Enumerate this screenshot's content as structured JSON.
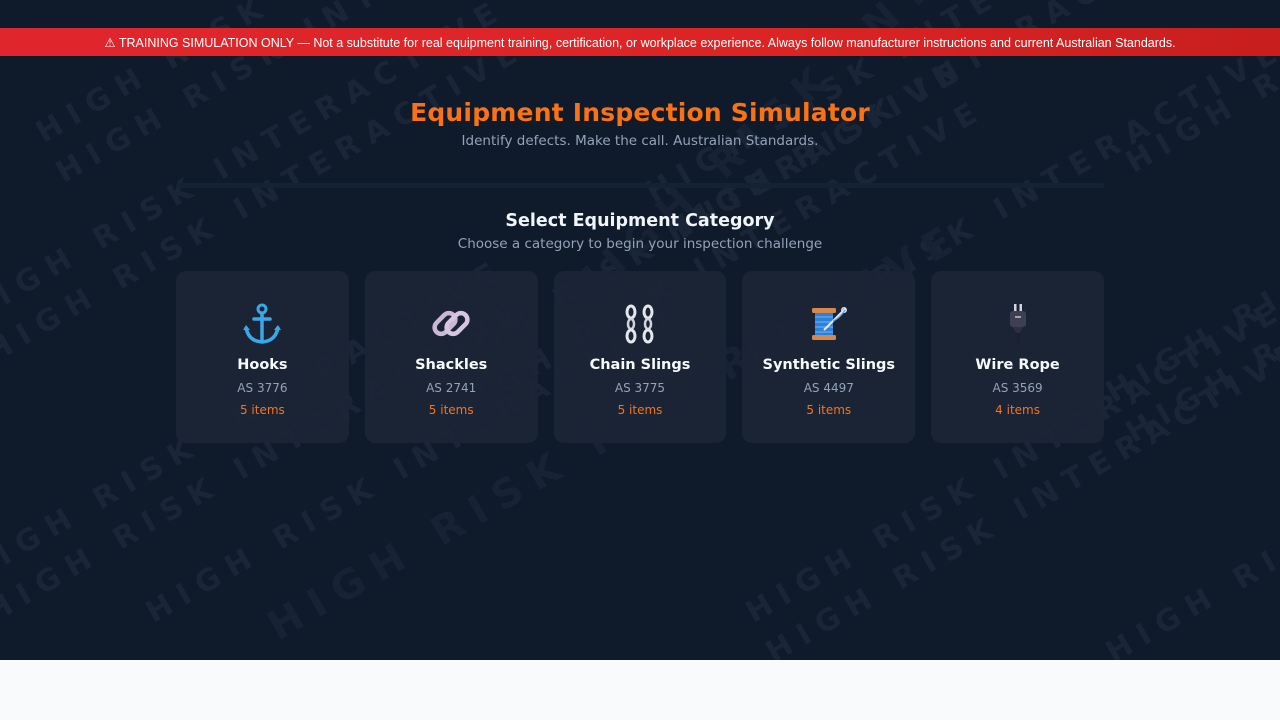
{
  "banner": {
    "text": "⚠ TRAINING SIMULATION ONLY — Not a substitute for real equipment training, certification, or workplace experience. Always follow manufacturer instructions and current Australian Standards."
  },
  "header": {
    "title": "Equipment Inspection Simulator",
    "subtitle": "Identify defects. Make the call. Australian Standards."
  },
  "section": {
    "title": "Select Equipment Category",
    "subtitle": "Choose a category to begin your inspection challenge"
  },
  "watermark": {
    "text": "HIGH RISK INTERACTIVE"
  },
  "categories": [
    {
      "name": "Hooks",
      "standard": "AS 3776",
      "count": "5 items",
      "icon": "anchor-icon"
    },
    {
      "name": "Shackles",
      "standard": "AS 2741",
      "count": "5 items",
      "icon": "link-icon"
    },
    {
      "name": "Chain Slings",
      "standard": "AS 3775",
      "count": "5 items",
      "icon": "chain-icon"
    },
    {
      "name": "Synthetic Slings",
      "standard": "AS 4497",
      "count": "5 items",
      "icon": "thread-spool-icon"
    },
    {
      "name": "Wire Rope",
      "standard": "AS 3569",
      "count": "4 items",
      "icon": "plug-icon"
    }
  ],
  "colors": {
    "background": "#0f1a2b",
    "accent": "#f97316",
    "banner": "#dc2626",
    "card": "#1b2536"
  }
}
